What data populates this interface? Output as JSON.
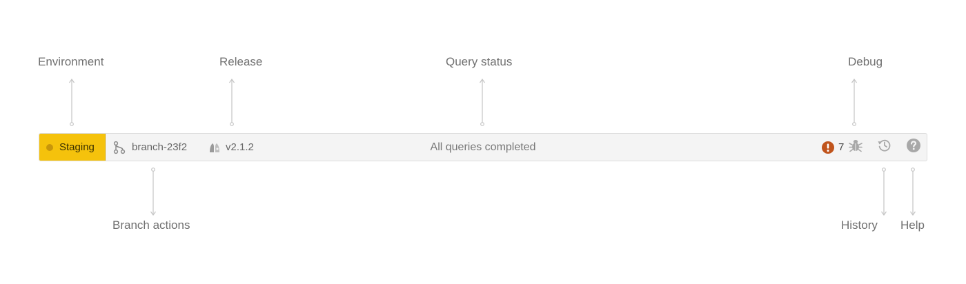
{
  "callouts": {
    "environment": "Environment",
    "release": "Release",
    "query_status": "Query status",
    "debug": "Debug",
    "branch_actions": "Branch actions",
    "history": "History",
    "help": "Help"
  },
  "statusbar": {
    "environment": {
      "label": "Staging",
      "color": "#f5c20c"
    },
    "branch": {
      "label": "branch-23f2",
      "icon": "git-branch-icon"
    },
    "release": {
      "label": "v2.1.2",
      "icon": "rocket-icon"
    },
    "query_status": "All queries completed",
    "errors": {
      "count": "7",
      "icon": "error-icon",
      "color": "#c0541c"
    },
    "debug_icon": "bug-icon",
    "history_icon": "history-icon",
    "help_icon": "help-icon"
  }
}
